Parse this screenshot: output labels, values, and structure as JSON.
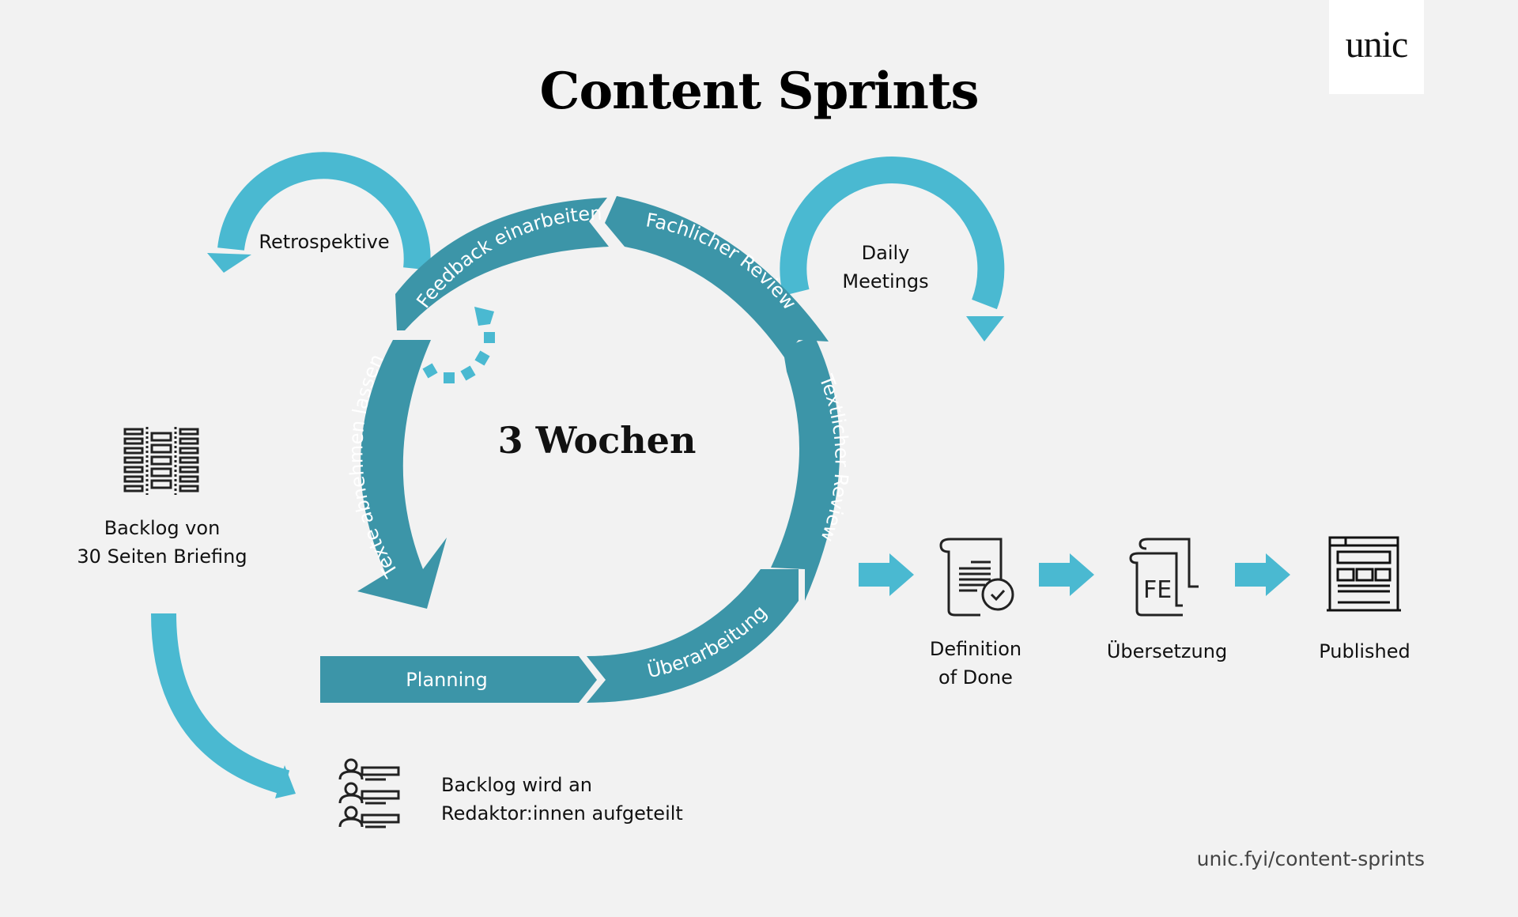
{
  "header": {
    "title": "Content Sprints",
    "logo": "unic"
  },
  "cycle": {
    "center_label": "3 Wochen",
    "stages": [
      {
        "label": "Planning"
      },
      {
        "label": "Überarbeitung"
      },
      {
        "label": "Textlicher Review"
      },
      {
        "label": "Fachlicher Review"
      },
      {
        "label": "Feedback einarbeiten"
      },
      {
        "label": "Texte abnehmen lassen"
      }
    ]
  },
  "loops": {
    "retrospektive": "Retrospektive",
    "daily_line1": "Daily",
    "daily_line2": "Meetings"
  },
  "backlog": {
    "line1": "Backlog von",
    "line2": "30 Seiten Briefing",
    "icon": "backlog-columns-icon"
  },
  "distribution": {
    "line1": "Backlog wird an",
    "line2": "Redaktor:innen aufgeteilt",
    "icon": "editors-list-icon"
  },
  "pipeline": [
    {
      "line1": "Definition",
      "line2": "of Done",
      "icon": "document-check-icon"
    },
    {
      "line1": "Übersetzung",
      "line2": "",
      "icon": "translation-document-icon",
      "icon_text": "FE"
    },
    {
      "line1": "Published",
      "line2": "",
      "icon": "webpage-icon"
    }
  ],
  "footer": {
    "url": "unic.fyi/content-sprints"
  },
  "colors": {
    "background": "#f2f2f2",
    "cycle_band": "#3c95a8",
    "loop_arrow": "#4ab9d1",
    "icon_stroke": "#222222",
    "text": "#111111"
  }
}
